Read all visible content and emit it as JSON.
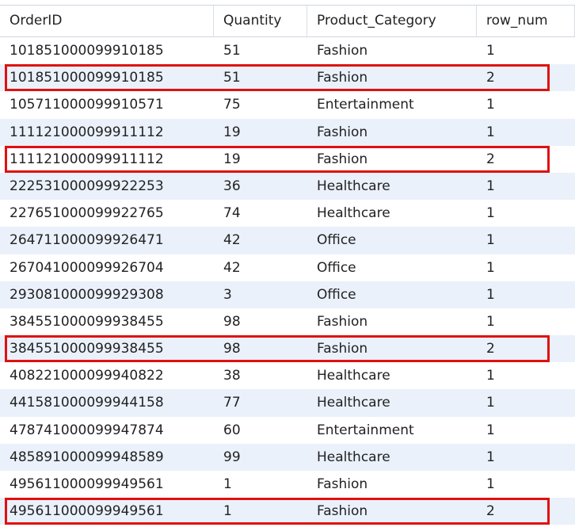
{
  "columns": [
    "OrderID",
    "Quantity",
    "Product_Category",
    "row_num"
  ],
  "rows": [
    {
      "order_id": "101851000099910185",
      "quantity": "51",
      "category": "Fashion",
      "row_num": "1",
      "highlighted": false
    },
    {
      "order_id": "101851000099910185",
      "quantity": "51",
      "category": "Fashion",
      "row_num": "2",
      "highlighted": true
    },
    {
      "order_id": "105711000099910571",
      "quantity": "75",
      "category": "Entertainment",
      "row_num": "1",
      "highlighted": false
    },
    {
      "order_id": "111121000099911112",
      "quantity": "19",
      "category": "Fashion",
      "row_num": "1",
      "highlighted": false
    },
    {
      "order_id": "111121000099911112",
      "quantity": "19",
      "category": "Fashion",
      "row_num": "2",
      "highlighted": true
    },
    {
      "order_id": "222531000099922253",
      "quantity": "36",
      "category": "Healthcare",
      "row_num": "1",
      "highlighted": false
    },
    {
      "order_id": "227651000099922765",
      "quantity": "74",
      "category": "Healthcare",
      "row_num": "1",
      "highlighted": false
    },
    {
      "order_id": "264711000099926471",
      "quantity": "42",
      "category": "Office",
      "row_num": "1",
      "highlighted": false
    },
    {
      "order_id": "267041000099926704",
      "quantity": "42",
      "category": "Office",
      "row_num": "1",
      "highlighted": false
    },
    {
      "order_id": "293081000099929308",
      "quantity": "3",
      "category": "Office",
      "row_num": "1",
      "highlighted": false
    },
    {
      "order_id": "384551000099938455",
      "quantity": "98",
      "category": "Fashion",
      "row_num": "1",
      "highlighted": false
    },
    {
      "order_id": "384551000099938455",
      "quantity": "98",
      "category": "Fashion",
      "row_num": "2",
      "highlighted": true
    },
    {
      "order_id": "408221000099940822",
      "quantity": "38",
      "category": "Healthcare",
      "row_num": "1",
      "highlighted": false
    },
    {
      "order_id": "441581000099944158",
      "quantity": "77",
      "category": "Healthcare",
      "row_num": "1",
      "highlighted": false
    },
    {
      "order_id": "478741000099947874",
      "quantity": "60",
      "category": "Entertainment",
      "row_num": "1",
      "highlighted": false
    },
    {
      "order_id": "485891000099948589",
      "quantity": "99",
      "category": "Healthcare",
      "row_num": "1",
      "highlighted": false
    },
    {
      "order_id": "495611000099949561",
      "quantity": "1",
      "category": "Fashion",
      "row_num": "1",
      "highlighted": false
    },
    {
      "order_id": "495611000099949561",
      "quantity": "1",
      "category": "Fashion",
      "row_num": "2",
      "highlighted": true
    }
  ],
  "colors": {
    "highlight": "#e01010",
    "row_alt": "#eaf1fb"
  }
}
